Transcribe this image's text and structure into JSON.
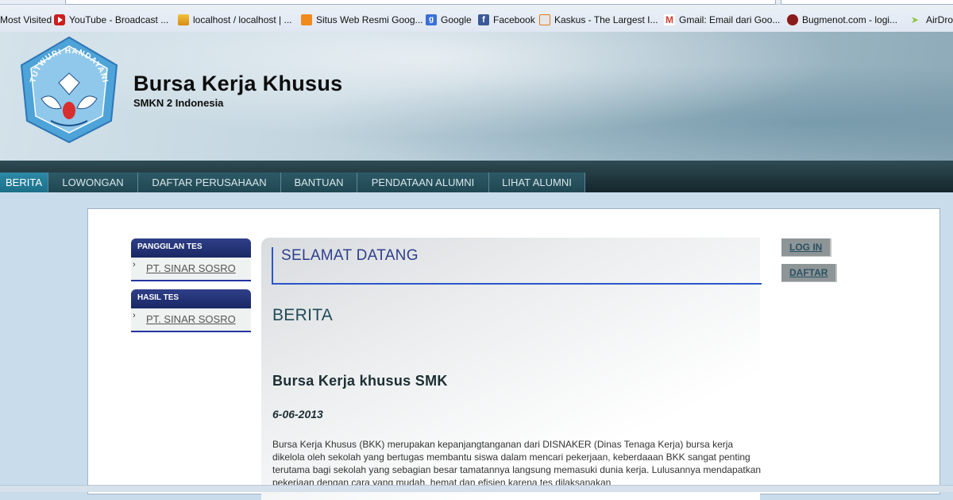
{
  "bookmarks": [
    {
      "label": "Most Visited",
      "icon": "none",
      "color": ""
    },
    {
      "label": "YouTube - Broadcast ...",
      "icon": "youtube-icon",
      "color": "#cc1e1e"
    },
    {
      "label": "localhost / localhost | ...",
      "icon": "pma-icon",
      "color": "#e2a21b"
    },
    {
      "label": "Situs Web Resmi Goog...",
      "icon": "blogger-icon",
      "color": "#f08a1c"
    },
    {
      "label": "Google",
      "icon": "google-icon",
      "color": "#3a6fd8"
    },
    {
      "label": "Facebook",
      "icon": "facebook-icon",
      "color": "#3b5998"
    },
    {
      "label": "Kaskus - The Largest I...",
      "icon": "kaskus-icon",
      "color": "#e6e6e6"
    },
    {
      "label": "Gmail: Email dari Goo...",
      "icon": "gmail-icon",
      "color": "#d23f31"
    },
    {
      "label": "Bugmenot.com - logi...",
      "icon": "bugmenot-icon",
      "color": "#8b1a1a"
    },
    {
      "label": "AirDro",
      "icon": "airdroid-icon",
      "color": "#8cc63f"
    }
  ],
  "header": {
    "logo_text": "TUTWURI HANDAYANI",
    "title": "Bursa Kerja Khusus",
    "subtitle": "SMKN 2 Indonesia"
  },
  "nav": {
    "tabs": [
      {
        "label": "BERITA",
        "active": true
      },
      {
        "label": "LOWONGAN",
        "active": false
      },
      {
        "label": "DAFTAR PERUSAHAAN",
        "active": false
      },
      {
        "label": "BANTUAN",
        "active": false
      },
      {
        "label": "PENDATAAN ALUMNI",
        "active": false
      },
      {
        "label": "LIHAT ALUMNI",
        "active": false
      }
    ]
  },
  "sidebar": {
    "boxes": [
      {
        "title": "PANGGILAN TES",
        "items": [
          {
            "label": "PT. SINAR SOSRO"
          }
        ]
      },
      {
        "title": "HASIL TES",
        "items": [
          {
            "label": "PT. SINAR SOSRO"
          }
        ]
      }
    ]
  },
  "content": {
    "welcome": "SELAMAT DATANG",
    "section_title": "BERITA",
    "article_title": "Bursa Kerja khusus SMK",
    "article_date": "6-06-2013",
    "article_body": "Bursa Kerja Khusus (BKK) merupakan kepanjangtanganan dari DISNAKER (Dinas Tenaga Kerja) bursa kerja dikelola oleh sekolah yang bertugas membantu siswa dalam mencari pekerjaan, keberdaaan BKK sangat penting terutama bagi sekolah yang sebagian besar tamatannya langsung memasuki dunia kerja. Lulusannya mendapatkan pekerjaan dengan cara yang mudah, hemat dan efisien karena tes dilaksanakan"
  },
  "auth": {
    "login_label": "LOG IN",
    "register_label": "DAFTAR"
  },
  "colors": {
    "nav_active": "#1c6f88",
    "sidebar_head": "#1a2865",
    "welcome_text": "#2f3e8c"
  }
}
